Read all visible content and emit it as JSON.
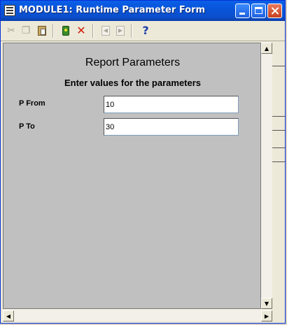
{
  "window": {
    "title": "MODULE1: Runtime Parameter Form"
  },
  "toolbar": {
    "buttons": [
      {
        "name": "cut",
        "icon": "scissors-icon",
        "enabled": false
      },
      {
        "name": "copy",
        "icon": "copy-icon",
        "enabled": false
      },
      {
        "name": "paste",
        "icon": "paste-icon",
        "enabled": true
      },
      {
        "name": "run",
        "icon": "run-report-icon",
        "enabled": true
      },
      {
        "name": "cancel",
        "icon": "red-x-icon",
        "enabled": true
      },
      {
        "name": "previous",
        "icon": "previous-page-icon",
        "enabled": false
      },
      {
        "name": "next",
        "icon": "next-page-icon",
        "enabled": false
      },
      {
        "name": "help",
        "icon": "help-icon",
        "enabled": true
      }
    ],
    "help_glyph": "?",
    "cancel_glyph": "✕",
    "cut_glyph": "✂",
    "copy_glyph": "❐",
    "prev_glyph": "◀",
    "next_glyph": "▶"
  },
  "form": {
    "heading": "Report Parameters",
    "subheading": "Enter values for the parameters",
    "parameters": [
      {
        "label": "P From",
        "value": "10"
      },
      {
        "label": "P To",
        "value": "30"
      }
    ]
  },
  "scrollbar": {
    "up": "▲",
    "down": "▼",
    "left": "◀",
    "right": "▶"
  },
  "colors": {
    "titlebar": "#0a5fe8",
    "form_background": "#c0c0c0",
    "close_button": "#c6401f"
  }
}
